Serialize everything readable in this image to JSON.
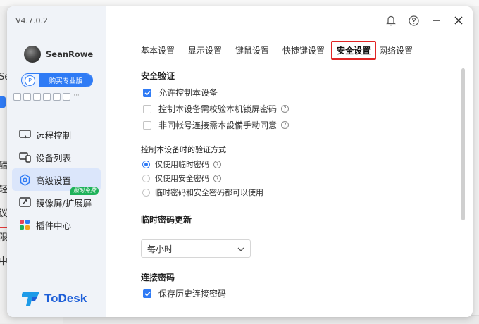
{
  "background": {
    "left_chars": [
      "Se",
      "醋",
      "轻",
      "议",
      "限",
      "中"
    ]
  },
  "sidebar": {
    "version": "V4.7.0.2",
    "username": "SeanRowe",
    "pro_badge_icon": "P",
    "pro_badge_label": "购买专业版",
    "feature_icons": [
      "gamepad-icon",
      "monitor-icon",
      "window-icon",
      "file-icon",
      "shield-icon",
      "cube-icon",
      "more-icon"
    ],
    "nav_items": [
      {
        "label": "远程控制",
        "icon": "remote-control-icon",
        "active": false
      },
      {
        "label": "设备列表",
        "icon": "device-list-icon",
        "active": false
      },
      {
        "label": "高级设置",
        "icon": "gear-icon",
        "active": true
      },
      {
        "label": "镜像屏/扩展屏",
        "icon": "mirror-screen-icon",
        "active": false,
        "tag": "限时免费"
      },
      {
        "label": "插件中心",
        "icon": "plugin-icon",
        "active": false
      }
    ],
    "brand": "ToDesk"
  },
  "tabs": [
    {
      "label": "基本设置",
      "active": false
    },
    {
      "label": "显示设置",
      "active": false
    },
    {
      "label": "键鼠设置",
      "active": false
    },
    {
      "label": "快捷键设置",
      "active": false
    },
    {
      "label": "安全设置",
      "active": true
    },
    {
      "label": "网络设置",
      "active": false
    }
  ],
  "security": {
    "title": "安全验证",
    "options": [
      {
        "label": "允许控制本设备",
        "checked": true,
        "help": false
      },
      {
        "label": "控制本设备需校验本机锁屏密码",
        "checked": false,
        "help": true
      },
      {
        "label": "非同帐号连接需本設備手动同意",
        "checked": false,
        "help": true
      }
    ]
  },
  "verify": {
    "title": "控制本设备时的验证方式",
    "options": [
      {
        "label": "仅使用临时密码",
        "selected": true,
        "help": true
      },
      {
        "label": "仅使用安全密码",
        "selected": false,
        "help": true
      },
      {
        "label": "临时密码和安全密码都可以使用",
        "selected": false,
        "help": false
      }
    ]
  },
  "temp_password": {
    "title": "临时密码更新",
    "value": "每小时"
  },
  "connect_password": {
    "title": "连接密码",
    "save_history_label": "保存历史连接密码",
    "save_history_checked": true
  },
  "help_glyph": "?",
  "colors": {
    "accent": "#2f7bf5",
    "highlight_border": "#e02525",
    "tag_green": "#1fb25a"
  }
}
